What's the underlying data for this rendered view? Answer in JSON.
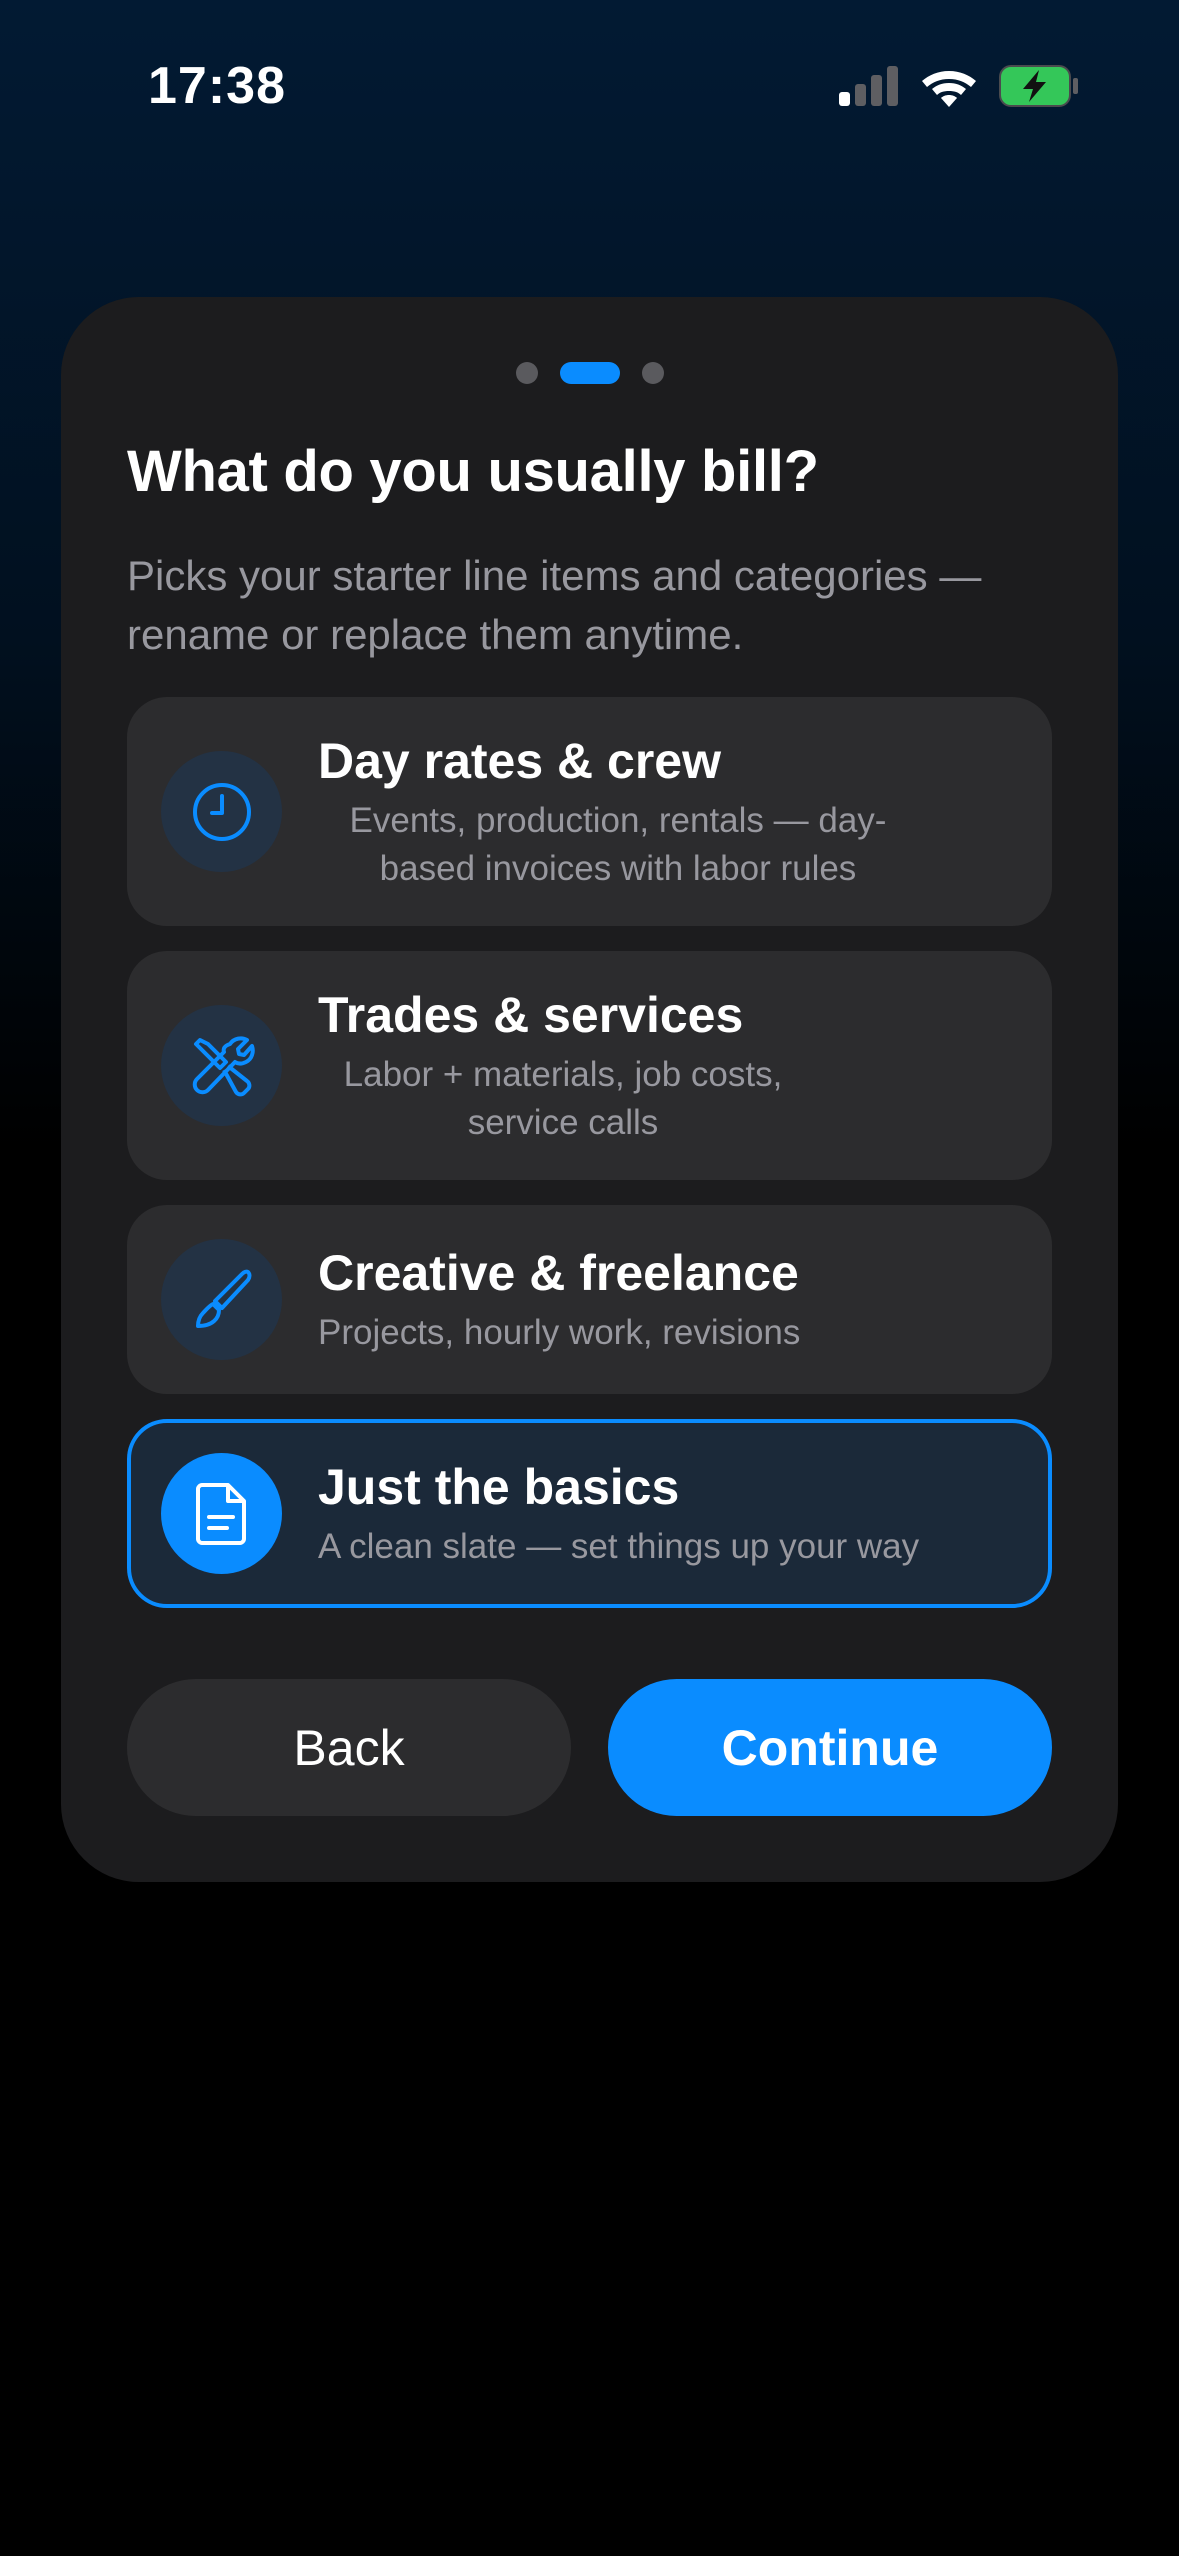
{
  "status_bar": {
    "time": "17:38",
    "icons": [
      "cellular-signal-icon",
      "wifi-icon",
      "battery-charging-icon"
    ]
  },
  "pager": {
    "total": 3,
    "active_index": 1
  },
  "onboarding": {
    "title": "What do you usually bill?",
    "subtitle": "Picks your starter line items and categories — rename or replace them anytime.",
    "options": [
      {
        "title": "Day rates & crew",
        "description": "Events, production, rentals — day-based invoices with labor rules",
        "icon": "clock-icon",
        "selected": false
      },
      {
        "title": "Trades & services",
        "description": "Labor + materials, job costs, service calls",
        "icon": "tools-icon",
        "selected": false
      },
      {
        "title": "Creative & freelance",
        "description": "Projects, hourly work, revisions",
        "icon": "paintbrush-icon",
        "selected": false
      },
      {
        "title": "Just the basics",
        "description": "A clean slate — set things up your way",
        "icon": "document-icon",
        "selected": true
      }
    ],
    "back_label": "Back",
    "continue_label": "Continue"
  },
  "colors": {
    "accent": "#0a8cff",
    "card_background": "#1c1c1e",
    "option_background": "#2c2c2e",
    "selected_background": "#1b2939",
    "secondary_text": "#98989f",
    "battery_green": "#34c759"
  }
}
